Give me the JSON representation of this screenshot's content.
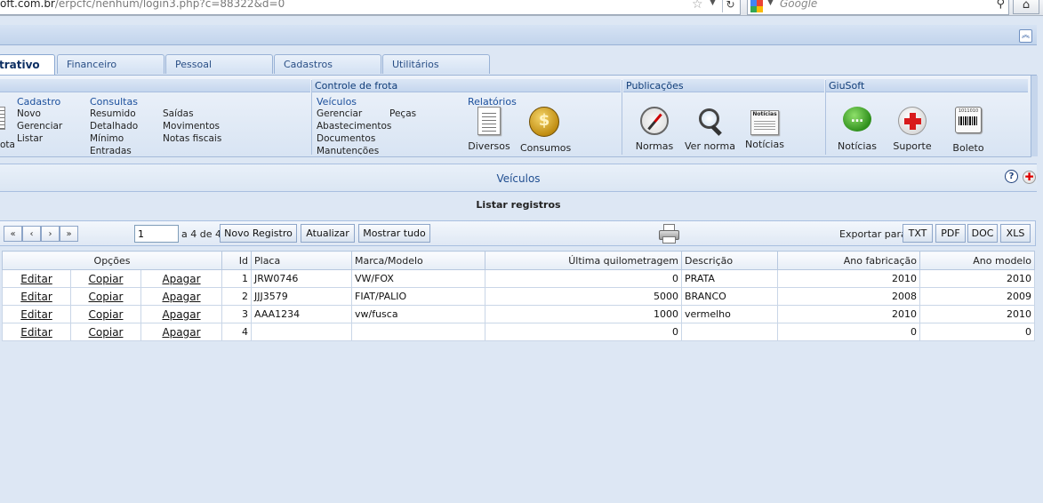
{
  "browser": {
    "url_visible": "oft.com.br",
    "url_rest": "/erpcfc/nenhum/login3.php?c=88322&d=0",
    "search_placeholder": "Google"
  },
  "tabs": [
    {
      "label": "trativo",
      "active": true
    },
    {
      "label": "Financeiro",
      "active": false
    },
    {
      "label": "Pessoal",
      "active": false
    },
    {
      "label": "Cadastros",
      "active": false
    },
    {
      "label": "Utilitários",
      "active": false
    }
  ],
  "ribbon": {
    "group1": {
      "cut_label": "ota",
      "cadastro": {
        "head": "Cadastro",
        "items": [
          "Novo",
          "Gerenciar",
          "Listar"
        ]
      },
      "consultas": {
        "head": "Consultas",
        "items": [
          "Resumido",
          "Detalhado",
          "Mínimo",
          "Entradas"
        ]
      },
      "more": [
        "Saídas",
        "Movimentos",
        "Notas fiscais"
      ]
    },
    "frota": {
      "title": "Controle de frota",
      "veiculos": {
        "head": "Veículos",
        "items": [
          "Gerenciar",
          "Abastecimentos",
          "Documentos",
          "Manutenções"
        ]
      },
      "pecas": "Peças",
      "relatorios": {
        "head": "Relatórios",
        "diversos": "Diversos",
        "consumos": "Consumos"
      }
    },
    "publicacoes": {
      "title": "Publicações",
      "normas": "Normas",
      "ver_norma": "Ver norma",
      "noticias": "Notícias",
      "news_icon_text": "Notícias"
    },
    "giusoft": {
      "title": "GiuSoft",
      "noticias": "Notícias",
      "suporte": "Suporte",
      "boleto": "Boleto",
      "barcode_text": "1011010"
    }
  },
  "panel": {
    "title": "Veículos",
    "subtitle": "Listar registros"
  },
  "toolbar": {
    "first": "«",
    "prev": "‹",
    "next": "›",
    "last": "»",
    "page_value": "1",
    "page_of": "a 4 de 4",
    "new_record": "Novo Registro",
    "refresh": "Atualizar",
    "show_all": "Mostrar tudo",
    "export_label": "Exportar para",
    "export_formats": [
      "TXT",
      "PDF",
      "DOC",
      "XLS"
    ]
  },
  "table": {
    "headers": {
      "options": "Opções",
      "id": "Id",
      "plate": "Placa",
      "model": "Marca/Modelo",
      "mileage": "Última quilometragem",
      "description": "Descrição",
      "year_made": "Ano fabricação",
      "year_model": "Ano modelo"
    },
    "actions": {
      "edit": "Editar",
      "copy": "Copiar",
      "delete": "Apagar"
    },
    "rows": [
      {
        "id": "1",
        "plate": "JRW0746",
        "model": "VW/FOX",
        "mileage": "0",
        "description": "PRATA",
        "year_made": "2010",
        "year_model": "2010"
      },
      {
        "id": "2",
        "plate": "JJJ3579",
        "model": "FIAT/PALIO",
        "mileage": "5000",
        "description": "BRANCO",
        "year_made": "2008",
        "year_model": "2009"
      },
      {
        "id": "3",
        "plate": "AAA1234",
        "model": "vw/fusca",
        "mileage": "1000",
        "description": "vermelho",
        "year_made": "2010",
        "year_model": "2010"
      },
      {
        "id": "4",
        "plate": "",
        "model": "",
        "mileage": "0",
        "description": "",
        "year_made": "0",
        "year_model": "0"
      }
    ]
  }
}
